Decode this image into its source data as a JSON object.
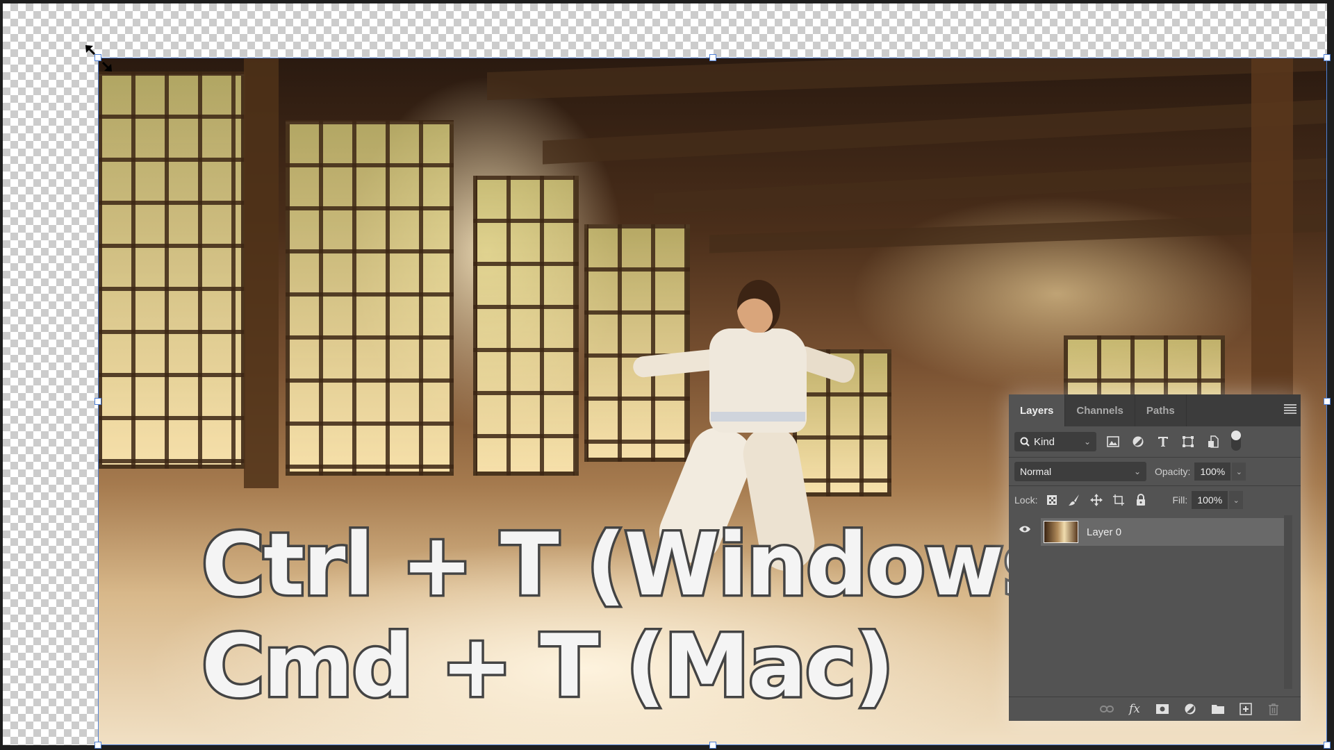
{
  "canvas": {
    "overlay_lines": [
      "Ctrl + T (Windows)",
      "Cmd + T (Mac)"
    ],
    "overlay_text_color": "#f4f4f4",
    "overlay_outline_color": "#444444",
    "transform_box_color": "#4d7fd6"
  },
  "layers_panel": {
    "tabs": [
      {
        "label": "Layers",
        "active": true
      },
      {
        "label": "Channels",
        "active": false
      },
      {
        "label": "Paths",
        "active": false
      }
    ],
    "menu_icon": "panel-menu-icon",
    "filter": {
      "kind_label": "Kind",
      "icons": [
        "pixel-layer-filter-icon",
        "adjustment-layer-filter-icon",
        "type-layer-filter-icon",
        "shape-layer-filter-icon",
        "smart-object-filter-icon"
      ],
      "filter_toggle": "on"
    },
    "blend_mode": "Normal",
    "opacity_label": "Opacity:",
    "opacity_value": "100%",
    "lock_label": "Lock:",
    "lock_icons": [
      "lock-transparent-pixels-icon",
      "lock-image-pixels-icon",
      "lock-position-icon",
      "lock-artboard-icon",
      "lock-all-icon"
    ],
    "fill_label": "Fill:",
    "fill_value": "100%",
    "layers": [
      {
        "name": "Layer 0",
        "visible": true,
        "selected": true
      }
    ],
    "footer_icons": [
      "link-layers-icon",
      "fx-icon",
      "add-mask-icon",
      "new-adjustment-icon",
      "new-group-icon",
      "new-layer-icon",
      "delete-layer-icon"
    ]
  }
}
